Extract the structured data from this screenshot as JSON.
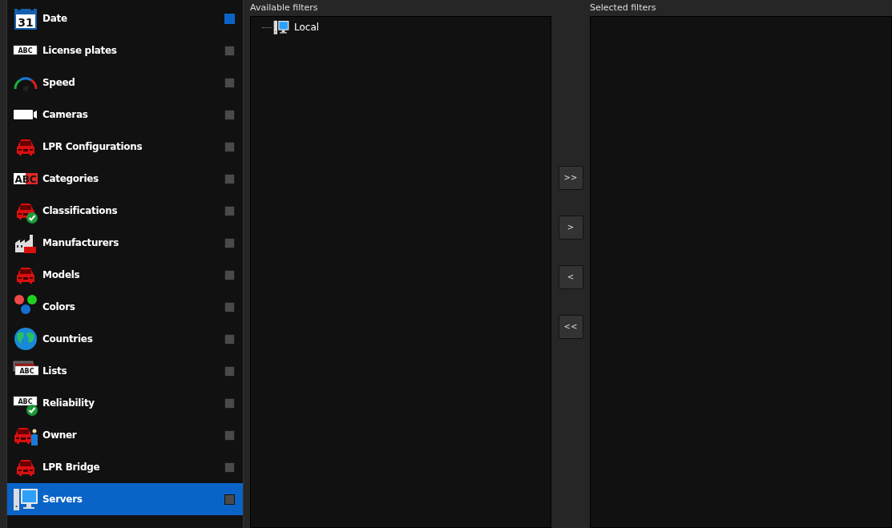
{
  "sidebar": {
    "items": [
      {
        "label": "Date",
        "kind": "calendar",
        "icon_text": "31",
        "checked": true,
        "selected": false
      },
      {
        "label": "License plates",
        "kind": "plate",
        "icon_text": "ABC",
        "checked": false,
        "selected": false
      },
      {
        "label": "Speed",
        "kind": "gauge",
        "checked": false,
        "selected": false
      },
      {
        "label": "Cameras",
        "kind": "camera",
        "checked": false,
        "selected": false
      },
      {
        "label": "LPR Configurations",
        "kind": "car",
        "checked": false,
        "selected": false
      },
      {
        "label": "Categories",
        "kind": "letters",
        "icon_text": "ABC",
        "checked": false,
        "selected": false
      },
      {
        "label": "Classifications",
        "kind": "car-check",
        "checked": false,
        "selected": false
      },
      {
        "label": "Manufacturers",
        "kind": "factory",
        "checked": false,
        "selected": false
      },
      {
        "label": "Models",
        "kind": "car",
        "checked": false,
        "selected": false
      },
      {
        "label": "Colors",
        "kind": "dots",
        "checked": false,
        "selected": false
      },
      {
        "label": "Countries",
        "kind": "globe",
        "checked": false,
        "selected": false
      },
      {
        "label": "Lists",
        "kind": "plate-stack",
        "icon_text": "ABC",
        "checked": false,
        "selected": false
      },
      {
        "label": "Reliability",
        "kind": "plate-check",
        "icon_text": "ABC",
        "checked": false,
        "selected": false
      },
      {
        "label": "Owner",
        "kind": "car-person",
        "checked": false,
        "selected": false
      },
      {
        "label": "LPR Bridge",
        "kind": "car",
        "checked": false,
        "selected": false
      },
      {
        "label": "Servers",
        "kind": "computer",
        "checked": false,
        "selected": true
      }
    ]
  },
  "available_filters": {
    "title": "Available filters",
    "tree": [
      {
        "label": "Local",
        "kind": "computer"
      }
    ]
  },
  "move_buttons": [
    ">>",
    ">",
    "<",
    "<<"
  ],
  "selected_filters": {
    "title": "Selected filters"
  }
}
